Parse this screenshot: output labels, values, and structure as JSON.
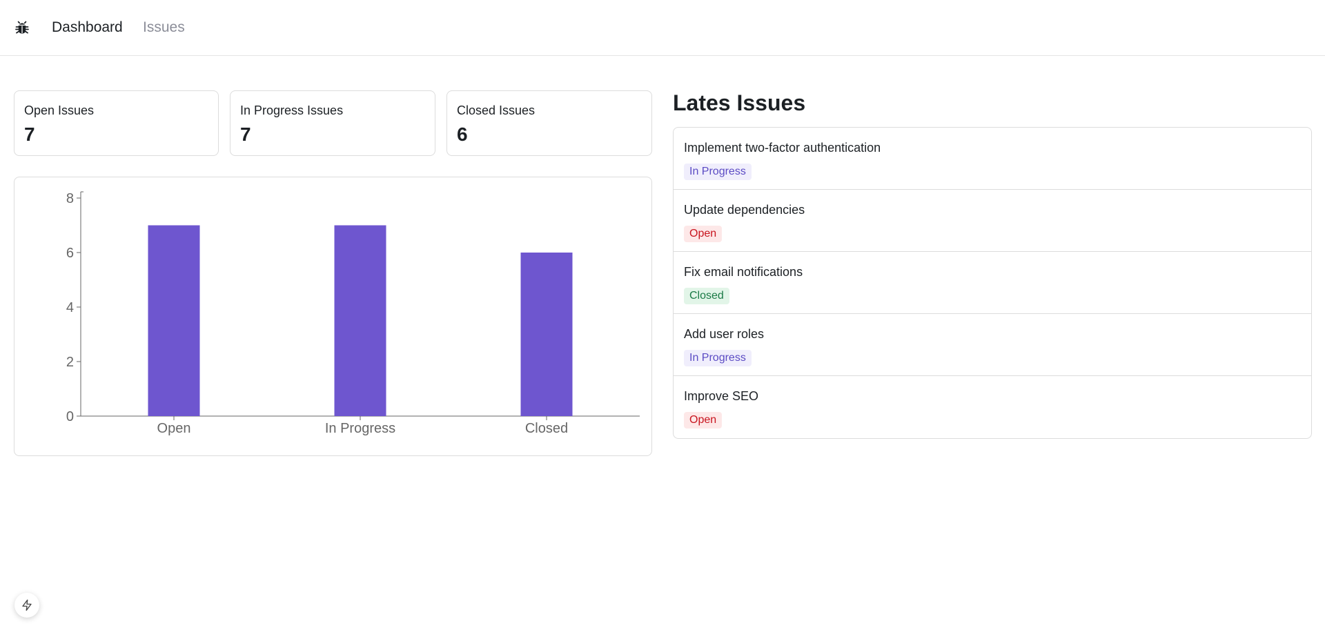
{
  "nav": {
    "logo_icon": "bug-icon",
    "items": [
      {
        "label": "Dashboard",
        "active": true
      },
      {
        "label": "Issues",
        "active": false
      }
    ]
  },
  "summary": {
    "open": {
      "label": "Open Issues",
      "value": "7"
    },
    "in_progress": {
      "label": "In Progress Issues",
      "value": "7"
    },
    "closed": {
      "label": "Closed Issues",
      "value": "6"
    }
  },
  "chart_data": {
    "type": "bar",
    "categories": [
      "Open",
      "In Progress",
      "Closed"
    ],
    "values": [
      7,
      7,
      6
    ],
    "ylim": [
      0,
      8
    ],
    "yticks": [
      0,
      2,
      4,
      6,
      8
    ],
    "bar_color": "#6e56cf",
    "grid": false
  },
  "latest": {
    "title": "Lates Issues",
    "issues": [
      {
        "title": "Implement two-factor authentication",
        "status": "In Progress"
      },
      {
        "title": "Update dependencies",
        "status": "Open"
      },
      {
        "title": "Fix email notifications",
        "status": "Closed"
      },
      {
        "title": "Add user roles",
        "status": "In Progress"
      },
      {
        "title": "Improve SEO",
        "status": "Open"
      }
    ]
  },
  "colors": {
    "accent": "#6e56cf",
    "open_badge_bg": "#fde8e8",
    "open_badge_text": "#c8141e",
    "progress_badge_bg": "#f0eefc",
    "progress_badge_text": "#5b4bc4",
    "closed_badge_bg": "#e2f5e8",
    "closed_badge_text": "#1a7a45"
  },
  "dev_indicator": {
    "icon": "lightning-icon"
  }
}
